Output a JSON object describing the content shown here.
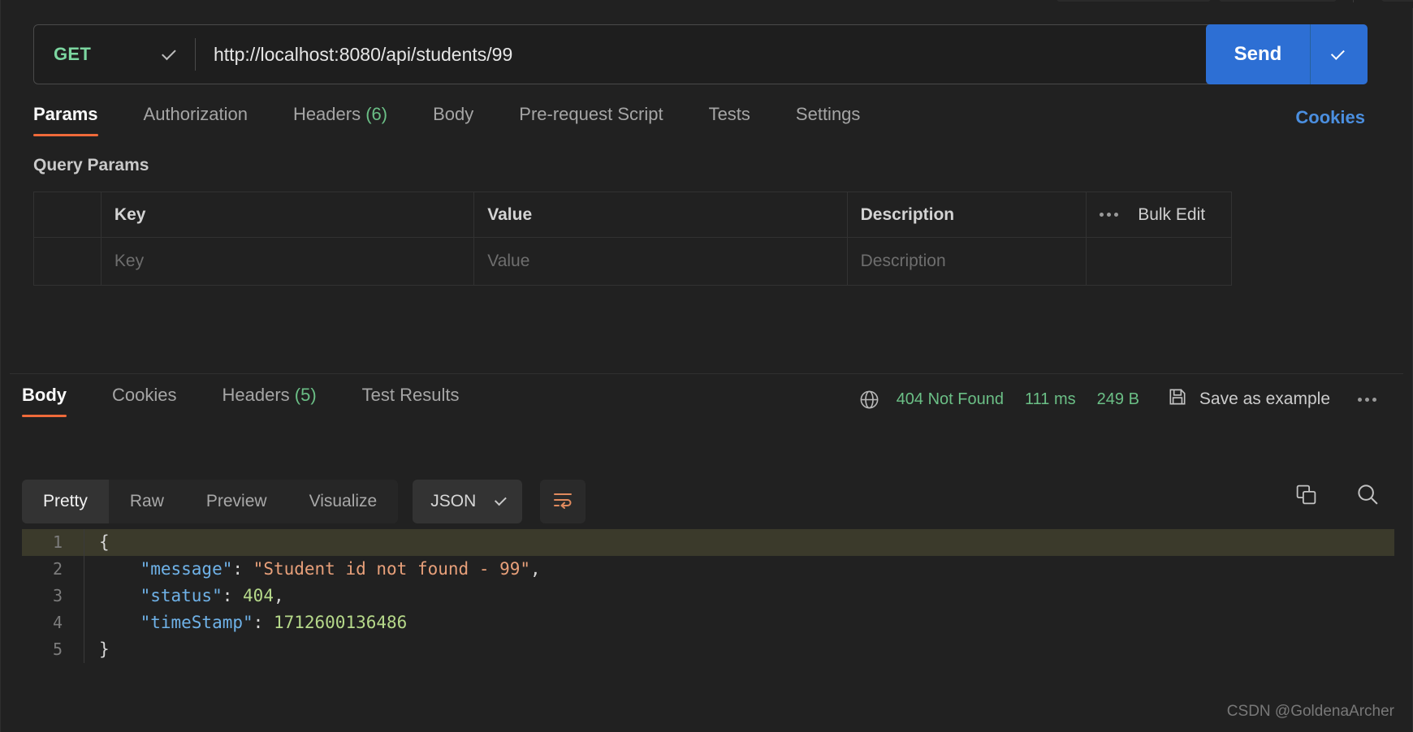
{
  "request": {
    "method": "GET",
    "url": "http://localhost:8080/api/students/99",
    "send_label": "Send",
    "tabs": [
      {
        "label": "Params",
        "count": "",
        "active": true
      },
      {
        "label": "Authorization",
        "count": "",
        "active": false
      },
      {
        "label": "Headers",
        "count": "(6)",
        "active": false
      },
      {
        "label": "Body",
        "count": "",
        "active": false
      },
      {
        "label": "Pre-request Script",
        "count": "",
        "active": false
      },
      {
        "label": "Tests",
        "count": "",
        "active": false
      },
      {
        "label": "Settings",
        "count": "",
        "active": false
      }
    ],
    "cookies_link": "Cookies"
  },
  "query_params": {
    "title": "Query Params",
    "columns": [
      "Key",
      "Value",
      "Description"
    ],
    "placeholders": {
      "key": "Key",
      "value": "Value",
      "description": "Description"
    },
    "bulk_edit_label": "Bulk Edit",
    "rows": []
  },
  "response": {
    "tabs": [
      {
        "label": "Body",
        "count": "",
        "active": true
      },
      {
        "label": "Cookies",
        "count": "",
        "active": false
      },
      {
        "label": "Headers",
        "count": "(5)",
        "active": false
      },
      {
        "label": "Test Results",
        "count": "",
        "active": false
      }
    ],
    "status": "404 Not Found",
    "time": "111 ms",
    "size": "249 B",
    "save_example_label": "Save as example",
    "view_modes": [
      {
        "label": "Pretty",
        "active": true
      },
      {
        "label": "Raw",
        "active": false
      },
      {
        "label": "Preview",
        "active": false
      },
      {
        "label": "Visualize",
        "active": false
      }
    ],
    "format": "JSON",
    "body_lines": [
      {
        "n": "1",
        "highlight": true,
        "tokens": [
          {
            "t": "{",
            "c": "k-pun"
          }
        ]
      },
      {
        "n": "2",
        "highlight": false,
        "tokens": [
          {
            "t": "    ",
            "c": "k-pun"
          },
          {
            "t": "\"message\"",
            "c": "k-key"
          },
          {
            "t": ": ",
            "c": "k-pun"
          },
          {
            "t": "\"Student id not found - 99\"",
            "c": "k-str"
          },
          {
            "t": ",",
            "c": "k-pun"
          }
        ]
      },
      {
        "n": "3",
        "highlight": false,
        "tokens": [
          {
            "t": "    ",
            "c": "k-pun"
          },
          {
            "t": "\"status\"",
            "c": "k-key"
          },
          {
            "t": ": ",
            "c": "k-pun"
          },
          {
            "t": "404",
            "c": "k-num"
          },
          {
            "t": ",",
            "c": "k-pun"
          }
        ]
      },
      {
        "n": "4",
        "highlight": false,
        "tokens": [
          {
            "t": "    ",
            "c": "k-pun"
          },
          {
            "t": "\"timeStamp\"",
            "c": "k-key"
          },
          {
            "t": ": ",
            "c": "k-pun"
          },
          {
            "t": "1712600136486",
            "c": "k-num"
          }
        ]
      },
      {
        "n": "5",
        "highlight": false,
        "tokens": [
          {
            "t": "}",
            "c": "k-pun"
          }
        ]
      }
    ]
  },
  "watermark": "CSDN @GoldenaArcher",
  "colors": {
    "accent_orange": "#ef6a3a",
    "send_blue": "#2d6fd4",
    "method_green": "#7cd6a0",
    "status_green": "#6bbf86",
    "link_blue": "#4b8fe0",
    "background": "#212121"
  }
}
